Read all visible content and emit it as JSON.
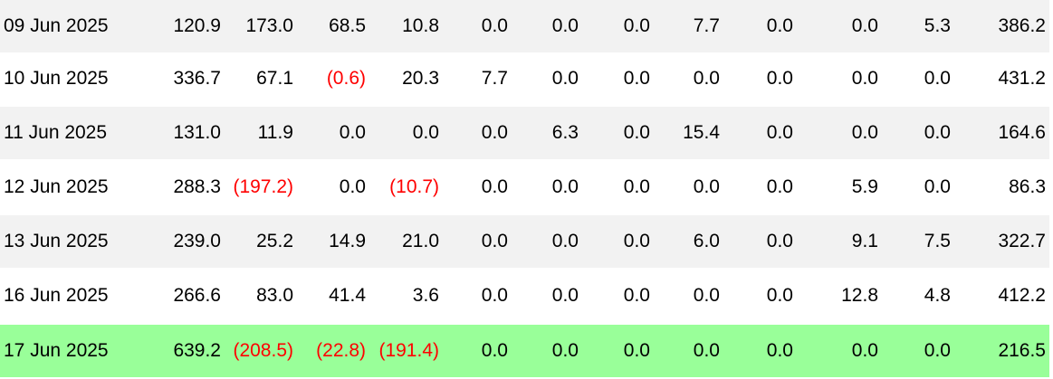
{
  "table": {
    "rows": [
      {
        "date": "09 Jun 2025",
        "values": [
          "120.9",
          "173.0",
          "68.5",
          "10.8",
          "0.0",
          "0.0",
          "0.0",
          "7.7",
          "0.0",
          "0.0",
          "5.3",
          "386.2"
        ],
        "negative": [
          false,
          false,
          false,
          false,
          false,
          false,
          false,
          false,
          false,
          false,
          false,
          false
        ],
        "highlight": false
      },
      {
        "date": "10 Jun 2025",
        "values": [
          "336.7",
          "67.1",
          "(0.6)",
          "20.3",
          "7.7",
          "0.0",
          "0.0",
          "0.0",
          "0.0",
          "0.0",
          "0.0",
          "431.2"
        ],
        "negative": [
          false,
          false,
          true,
          false,
          false,
          false,
          false,
          false,
          false,
          false,
          false,
          false
        ],
        "highlight": false
      },
      {
        "date": "11 Jun 2025",
        "values": [
          "131.0",
          "11.9",
          "0.0",
          "0.0",
          "0.0",
          "6.3",
          "0.0",
          "15.4",
          "0.0",
          "0.0",
          "0.0",
          "164.6"
        ],
        "negative": [
          false,
          false,
          false,
          false,
          false,
          false,
          false,
          false,
          false,
          false,
          false,
          false
        ],
        "highlight": false
      },
      {
        "date": "12 Jun 2025",
        "values": [
          "288.3",
          "(197.2)",
          "0.0",
          "(10.7)",
          "0.0",
          "0.0",
          "0.0",
          "0.0",
          "0.0",
          "5.9",
          "0.0",
          "86.3"
        ],
        "negative": [
          false,
          true,
          false,
          true,
          false,
          false,
          false,
          false,
          false,
          false,
          false,
          false
        ],
        "highlight": false
      },
      {
        "date": "13 Jun 2025",
        "values": [
          "239.0",
          "25.2",
          "14.9",
          "21.0",
          "0.0",
          "0.0",
          "0.0",
          "6.0",
          "0.0",
          "9.1",
          "7.5",
          "322.7"
        ],
        "negative": [
          false,
          false,
          false,
          false,
          false,
          false,
          false,
          false,
          false,
          false,
          false,
          false
        ],
        "highlight": false
      },
      {
        "date": "16 Jun 2025",
        "values": [
          "266.6",
          "83.0",
          "41.4",
          "3.6",
          "0.0",
          "0.0",
          "0.0",
          "0.0",
          "0.0",
          "12.8",
          "4.8",
          "412.2"
        ],
        "negative": [
          false,
          false,
          false,
          false,
          false,
          false,
          false,
          false,
          false,
          false,
          false,
          false
        ],
        "highlight": false
      },
      {
        "date": "17 Jun 2025",
        "values": [
          "639.2",
          "(208.5)",
          "(22.8)",
          "(191.4)",
          "0.0",
          "0.0",
          "0.0",
          "0.0",
          "0.0",
          "0.0",
          "0.0",
          "216.5"
        ],
        "negative": [
          false,
          true,
          true,
          true,
          false,
          false,
          false,
          false,
          false,
          false,
          false,
          false
        ],
        "highlight": true
      }
    ]
  },
  "colors": {
    "row_alt": "#f2f2f2",
    "row_plain": "#ffffff",
    "row_highlight": "#99ff99",
    "negative_text": "#ff0000",
    "positive_text": "#000000"
  }
}
